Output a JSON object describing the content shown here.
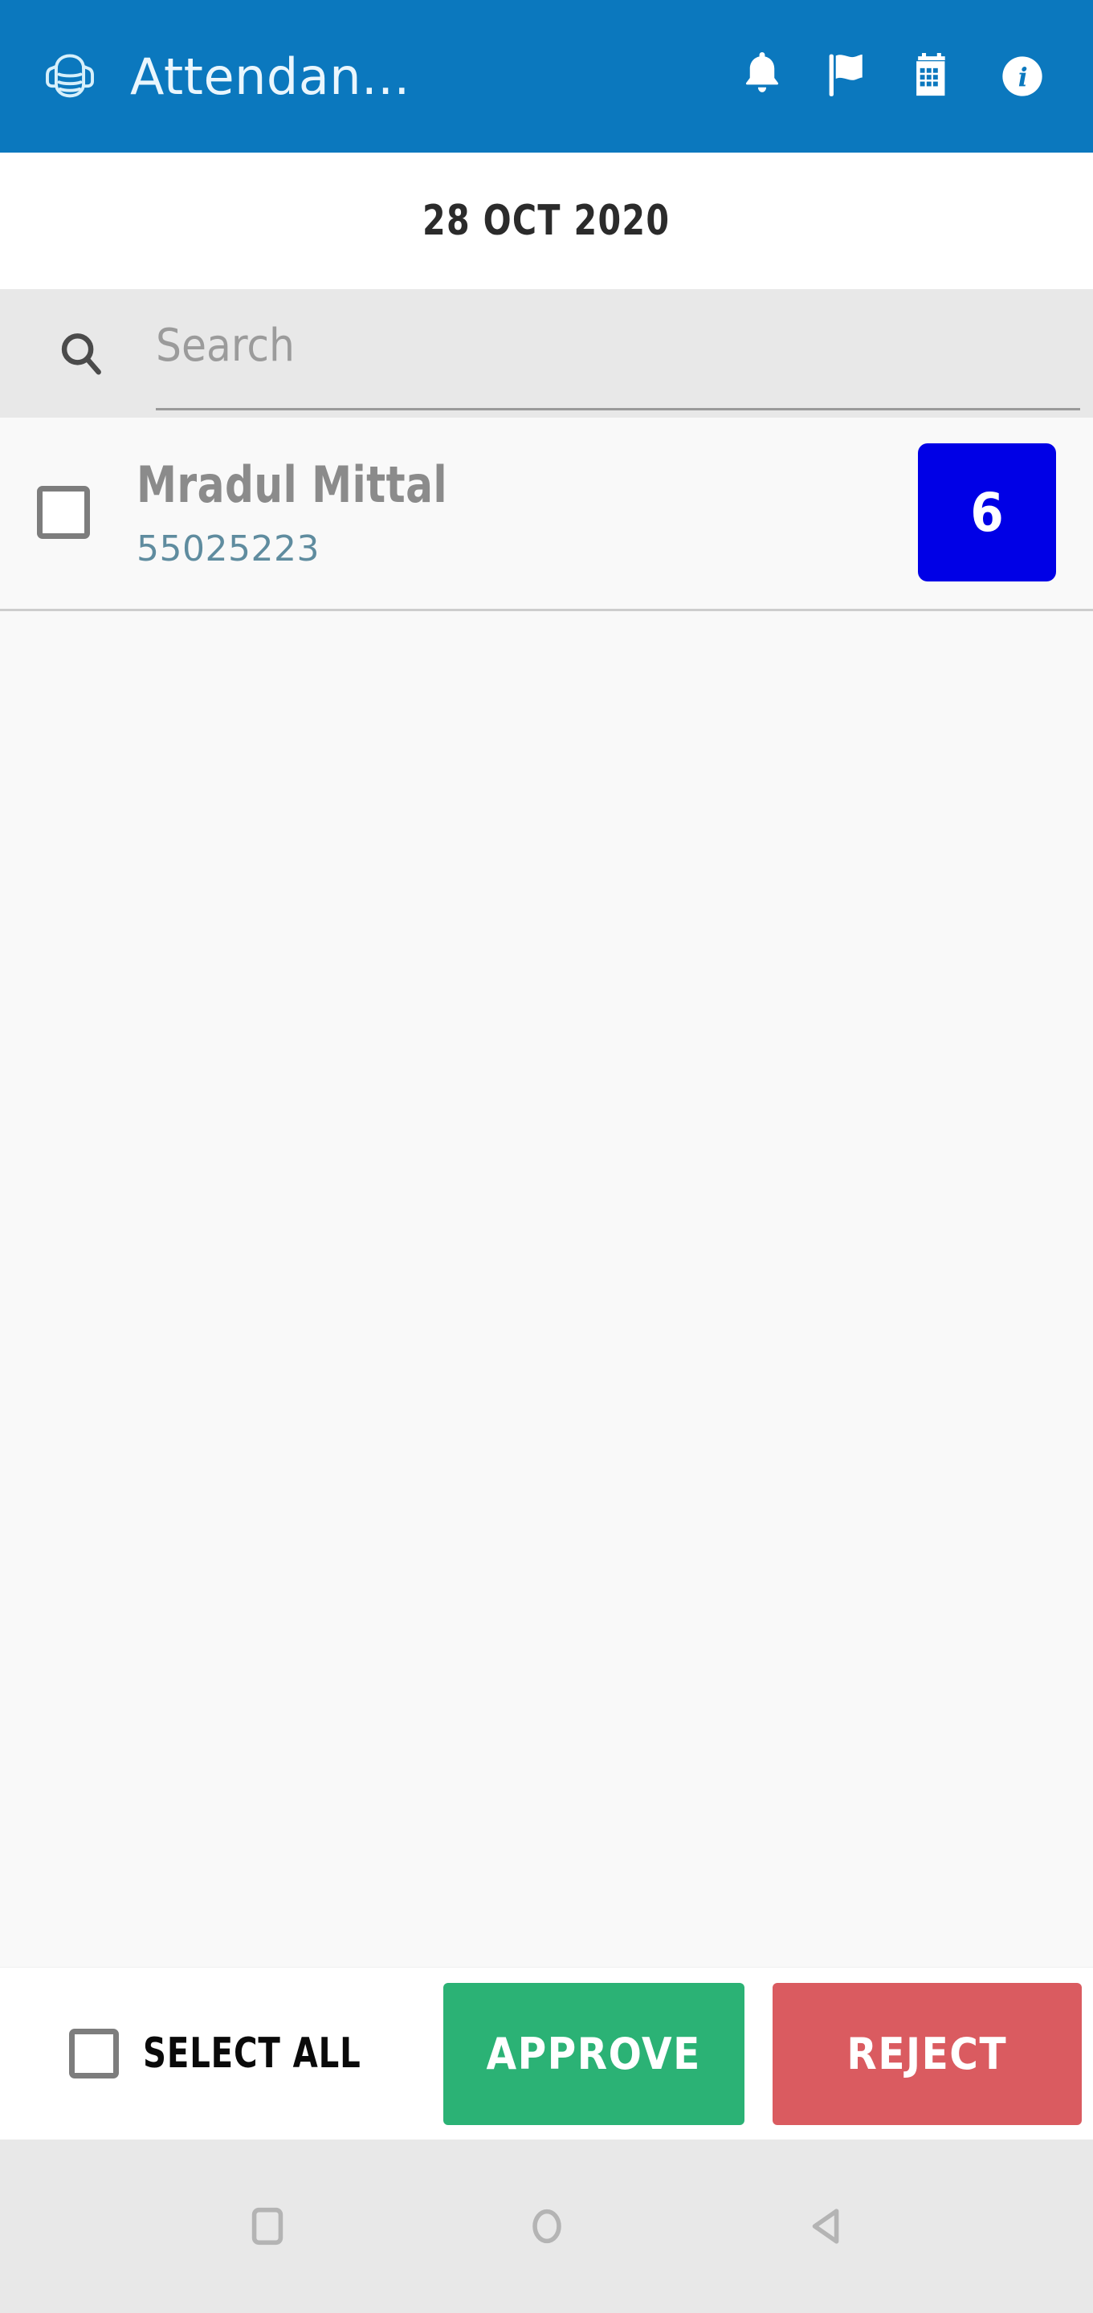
{
  "appbar": {
    "brand_icon": "face-mask-icon",
    "title": "Attendan...",
    "actions": [
      {
        "icon": "bell-icon",
        "label": "Notifications"
      },
      {
        "icon": "flag-icon",
        "label": "Flags"
      },
      {
        "icon": "calendar-icon",
        "label": "Calendar"
      },
      {
        "icon": "info-icon",
        "label": "Information"
      }
    ],
    "background_color": "#0b78be",
    "text_color": "#eaf6fd"
  },
  "date_bar": {
    "date": "28 OCT 2020"
  },
  "search": {
    "icon": "search-icon",
    "placeholder": "Search",
    "value": "",
    "background_color": "#e8e8e8"
  },
  "list": {
    "rows": [
      {
        "checked": false,
        "name": "Mradul Mittal",
        "employee_id": "55025223",
        "badge_count": "6",
        "badge_color": "#0000e6",
        "id_color": "#5f8c9f"
      }
    ]
  },
  "action_bar": {
    "select_all_label": "SELECT ALL",
    "select_all_checked": false,
    "approve_label": "APPROVE",
    "reject_label": "REJECT",
    "approve_color": "#2bb275",
    "reject_color": "#da5b60"
  },
  "navbar": {
    "background_color": "#e8e8e8",
    "buttons": [
      {
        "icon": "recents-square-icon",
        "label": "Recents"
      },
      {
        "icon": "home-circle-icon",
        "label": "Home"
      },
      {
        "icon": "back-triangle-icon",
        "label": "Back"
      }
    ]
  }
}
